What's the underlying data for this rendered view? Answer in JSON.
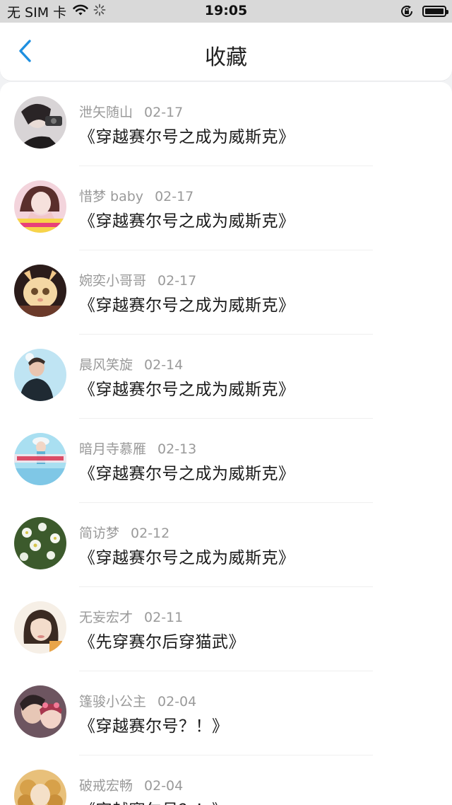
{
  "status_bar": {
    "carrier": "无 SIM 卡",
    "time": "19:05",
    "icons": [
      "wifi-icon",
      "activity-spinner-icon",
      "orientation-lock-icon",
      "battery-icon"
    ]
  },
  "nav": {
    "back_icon": "chevron-left-icon",
    "title": "收藏"
  },
  "colors": {
    "accent": "#1e8fe0",
    "status_bar_bg": "#d9d9d9",
    "page_bg": "#f1f2f4",
    "meta_text": "#9a9a9a",
    "title_text": "#1a1a1a"
  },
  "favorites": [
    {
      "user": "泄矢随山",
      "date": "02-17",
      "title": "《穿越赛尔号之成为威斯克》"
    },
    {
      "user": "惜梦 baby",
      "date": "02-17",
      "title": "《穿越赛尔号之成为威斯克》"
    },
    {
      "user": "婉奕小哥哥",
      "date": "02-17",
      "title": "《穿越赛尔号之成为威斯克》"
    },
    {
      "user": "晨风笑旋",
      "date": "02-14",
      "title": "《穿越赛尔号之成为威斯克》"
    },
    {
      "user": "暗月寺慕雁",
      "date": "02-13",
      "title": "《穿越赛尔号之成为威斯克》"
    },
    {
      "user": "简访梦",
      "date": "02-12",
      "title": "《穿越赛尔号之成为威斯克》"
    },
    {
      "user": "无妄宏才",
      "date": "02-11",
      "title": "《先穿赛尔后穿猫武》"
    },
    {
      "user": "篷骏小公主",
      "date": "02-04",
      "title": "《穿越赛尔号？！》"
    },
    {
      "user": "破戒宏畅",
      "date": "02-04",
      "title": "《穿越赛尔号？！》"
    }
  ]
}
